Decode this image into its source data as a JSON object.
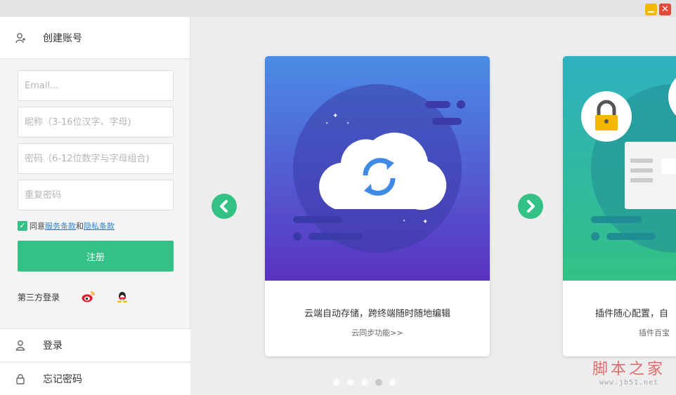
{
  "window": {
    "close_label": "✕"
  },
  "sidebar": {
    "create_account_label": "创建账号",
    "email_placeholder": "Email...",
    "nickname_placeholder": "昵称（3-16位汉字、字母)",
    "password_placeholder": "密码（6-12位数字与字母组合)",
    "repeat_password_placeholder": "重复密码",
    "agree_prefix": "同意",
    "terms_link": "服务条款",
    "agree_and": "和",
    "privacy_link": "隐私条款",
    "agreed": true,
    "register_label": "注册",
    "third_party_label": "第三方登录",
    "login_label": "登录",
    "forgot_label": "忘记密码"
  },
  "carousel": {
    "cards": [
      {
        "title": "云端自动存储，跨终端随时随地编辑",
        "link": "云同步功能>>"
      },
      {
        "title": "插件随心配置，自",
        "link": "插件百宝"
      }
    ],
    "dot_count": 5,
    "active_dot": 3
  },
  "watermark": {
    "line1": "脚本之家",
    "line2": "www.jb51.net"
  },
  "colors": {
    "accent": "#33c185",
    "card1_top": "#4a8de6",
    "card1_bottom": "#5b32c0",
    "card2_top": "#2fb0c0",
    "card2_bottom": "#33c185"
  }
}
